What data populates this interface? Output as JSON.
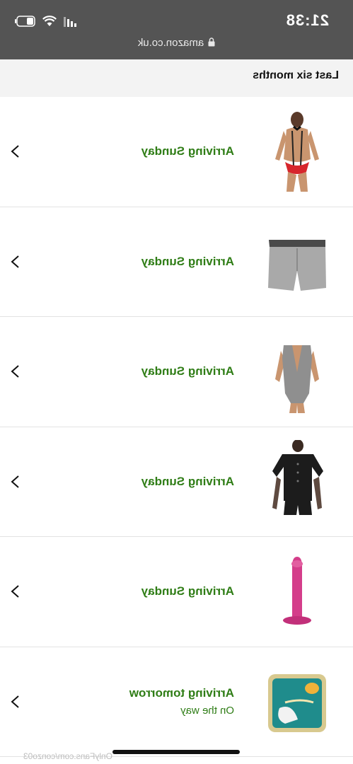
{
  "status_bar": {
    "time": "21:38"
  },
  "browser": {
    "url": "amazon.co.uk"
  },
  "section": {
    "title": "Last six months"
  },
  "orders": [
    {
      "status": "Arriving Sunday",
      "substatus": "",
      "image": "harness-lingerie-image"
    },
    {
      "status": "Arriving Sunday",
      "substatus": "",
      "image": "grey-boxer-shorts-image"
    },
    {
      "status": "Arriving Sunday",
      "substatus": "",
      "image": "grey-bodysuit-image"
    },
    {
      "status": "Arriving Sunday",
      "substatus": "",
      "image": "black-romper-image"
    },
    {
      "status": "Arriving Sunday",
      "substatus": "",
      "image": "pink-toy-image"
    },
    {
      "status": "Arriving tomorrow",
      "substatus": "On the way",
      "image": "cat-food-tray-image"
    }
  ],
  "watermark": "OnlyFans.com/conzo03",
  "colors": {
    "status_green": "#2f7d16",
    "browser_bar": "#545454",
    "header_bg": "#f3f3f3"
  }
}
